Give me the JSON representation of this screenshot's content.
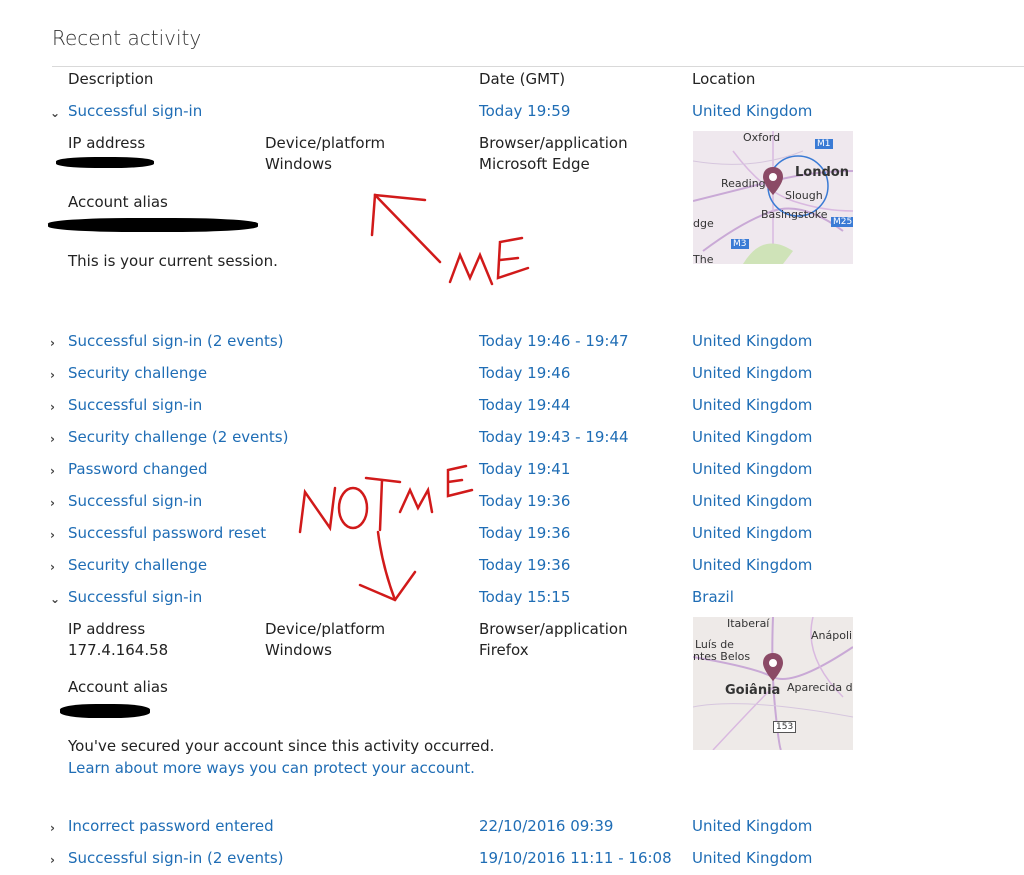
{
  "page": {
    "title": "Recent activity"
  },
  "columns": {
    "description": "Description",
    "date": "Date (GMT)",
    "location": "Location"
  },
  "first": {
    "description": "Successful sign-in",
    "time": "Today 19:59",
    "location": "United Kingdom",
    "ip_label": "IP address",
    "device_label": "Device/platform",
    "device": "Windows",
    "browser_label": "Browser/application",
    "browser": "Microsoft Edge",
    "alias_label": "Account alias",
    "note": "This is your current session.",
    "map_labels": [
      "Oxford",
      "London",
      "Reading",
      "Slough",
      "Basingstoke",
      "dge",
      "The",
      "M1",
      "M25",
      "M3"
    ]
  },
  "rows": [
    {
      "description": "Successful sign-in (2 events)",
      "time": "Today 19:46 - 19:47",
      "location": "United Kingdom"
    },
    {
      "description": "Security challenge",
      "time": "Today 19:46",
      "location": "United Kingdom"
    },
    {
      "description": "Successful sign-in",
      "time": "Today 19:44",
      "location": "United Kingdom"
    },
    {
      "description": "Security challenge (2 events)",
      "time": "Today 19:43 - 19:44",
      "location": "United Kingdom"
    },
    {
      "description": "Password changed",
      "time": "Today 19:41",
      "location": "United Kingdom"
    },
    {
      "description": "Successful sign-in",
      "time": "Today 19:36",
      "location": "United Kingdom"
    },
    {
      "description": "Successful password reset",
      "time": "Today 19:36",
      "location": "United Kingdom"
    },
    {
      "description": "Security challenge",
      "time": "Today 19:36",
      "location": "United Kingdom"
    }
  ],
  "second": {
    "description": "Successful sign-in",
    "time": "Today 15:15",
    "location": "Brazil",
    "ip_label": "IP address",
    "ip": "177.4.164.58",
    "device_label": "Device/platform",
    "device": "Windows",
    "browser_label": "Browser/application",
    "browser": "Firefox",
    "alias_label": "Account alias",
    "note": "You've secured your account since this activity occurred.",
    "link": "Learn about more ways you can protect your account.",
    "map_labels": [
      "Itaberaí",
      "Anápoli",
      "Luís de",
      "ntes Belos",
      "Goiânia",
      "Aparecida de",
      "153"
    ]
  },
  "rows_after": [
    {
      "description": "Incorrect password entered",
      "time": "22/10/2016 09:39",
      "location": "United Kingdom"
    },
    {
      "description": "Successful sign-in (2 events)",
      "time": "19/10/2016 11:11 - 16:08",
      "location": "United Kingdom"
    }
  ],
  "annotations": {
    "me": "ME",
    "not_me": "NOT ME"
  },
  "colors": {
    "link": "#1f6db5",
    "annotation": "#d11a1a",
    "pin": "#8b4a66"
  }
}
